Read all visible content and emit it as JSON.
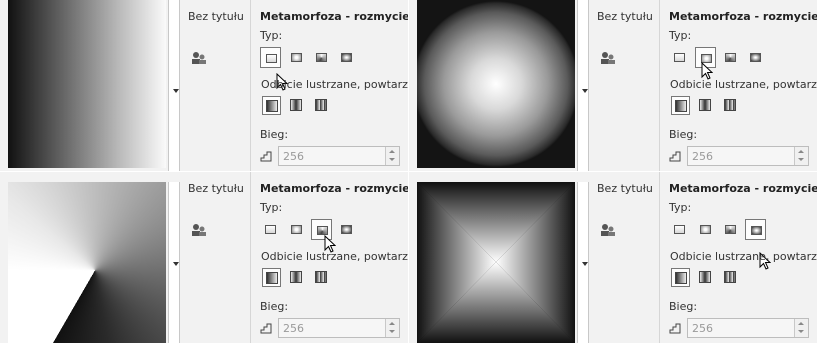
{
  "panels": [
    {
      "doc_title": "Bez tytułu",
      "heading": "Metamorfoza - rozmycie:",
      "type_label": "Typ:",
      "mirror_label": "Odbicie lustrzane, powtarza",
      "steps_label": "Bieg:",
      "steps_value": "256",
      "selected_type": "linear",
      "gradient_preview": "linear"
    },
    {
      "doc_title": "Bez tytułu",
      "heading": "Metamorfoza - rozmycie:",
      "type_label": "Typ:",
      "mirror_label": "Odbicie lustrzane, powtarza",
      "steps_label": "Bieg:",
      "steps_value": "256",
      "selected_type": "radial",
      "gradient_preview": "radial"
    },
    {
      "doc_title": "Bez tytułu",
      "heading": "Metamorfoza - rozmycie:",
      "type_label": "Typ:",
      "mirror_label": "Odbicie lustrzane, powtarza",
      "steps_label": "Bieg:",
      "steps_value": "256",
      "selected_type": "conical",
      "gradient_preview": "conical"
    },
    {
      "doc_title": "Bez tytułu",
      "heading": "Metamorfoza - rozmycie:",
      "type_label": "Typ:",
      "mirror_label": "Odbicie lustrzane, powtarza",
      "steps_label": "Bieg:",
      "steps_value": "256",
      "selected_type": "square",
      "gradient_preview": "square"
    }
  ],
  "gradient_types": [
    "linear",
    "radial",
    "conical",
    "square"
  ],
  "mirror_options": [
    "default",
    "mirror",
    "repeat"
  ],
  "icons": {
    "object_icon": "people-icon",
    "steps_icon": "steps-icon",
    "pointer": "mouse-pointer-icon"
  }
}
